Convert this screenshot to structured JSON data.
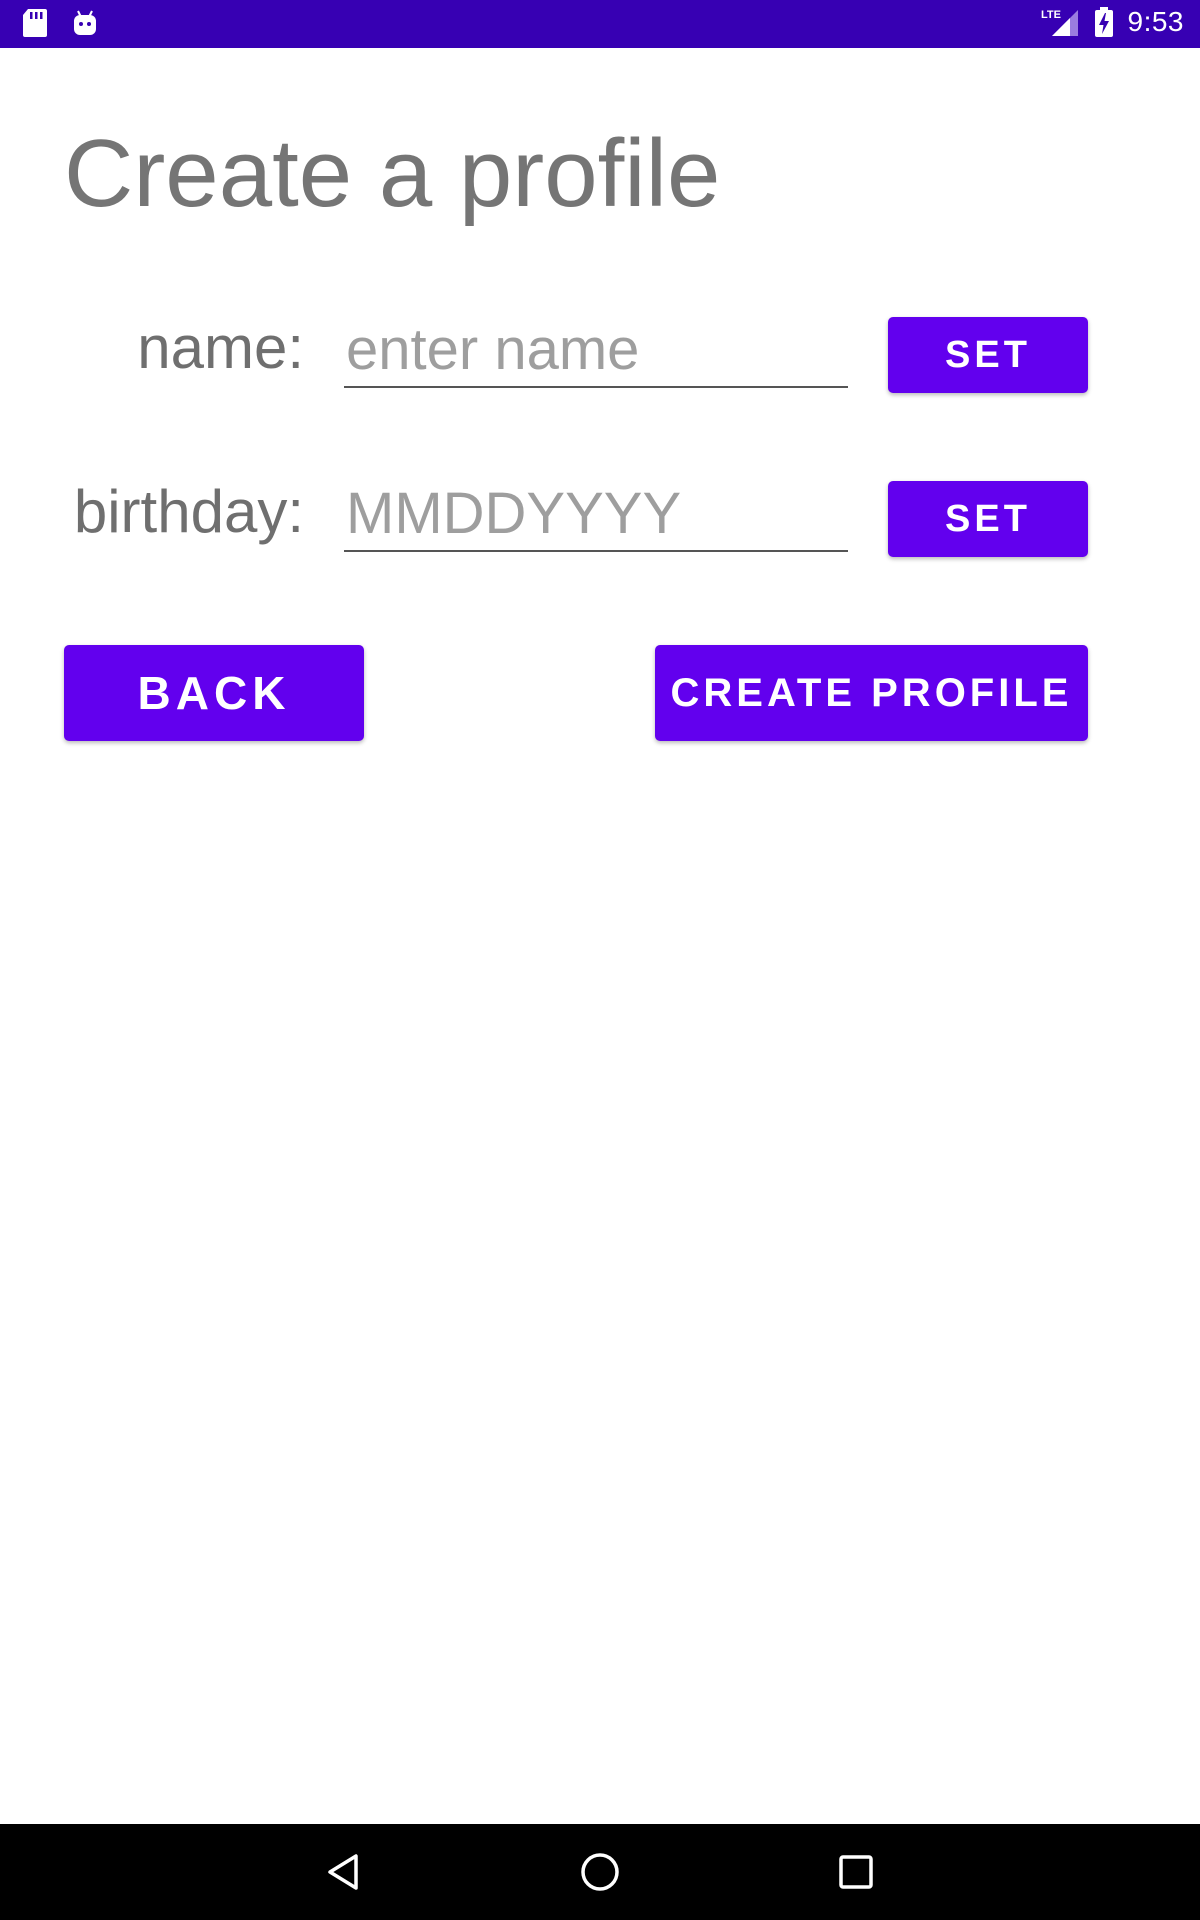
{
  "status_bar": {
    "time": "9:53",
    "network_label": "LTE",
    "icons": [
      "sd-card-icon",
      "android-icon",
      "lte-signal-icon",
      "battery-charging-icon"
    ]
  },
  "page": {
    "title": "Create a profile"
  },
  "form": {
    "name": {
      "label": "name:",
      "placeholder": "enter name",
      "value": "",
      "set_label": "SET"
    },
    "birthday": {
      "label": "birthday:",
      "placeholder": "MMDDYYYY",
      "value": "",
      "set_label": "SET"
    }
  },
  "actions": {
    "back_label": "BACK",
    "create_label": "CREATE PROFILE"
  },
  "nav_bar": {
    "icons": [
      "back-triangle-icon",
      "home-circle-icon",
      "recents-square-icon"
    ]
  },
  "colors": {
    "status_bar": "#3700b3",
    "accent": "#6200ee",
    "title_text": "#757575",
    "placeholder_text": "#9e9e9e",
    "nav_bar": "#000000"
  }
}
